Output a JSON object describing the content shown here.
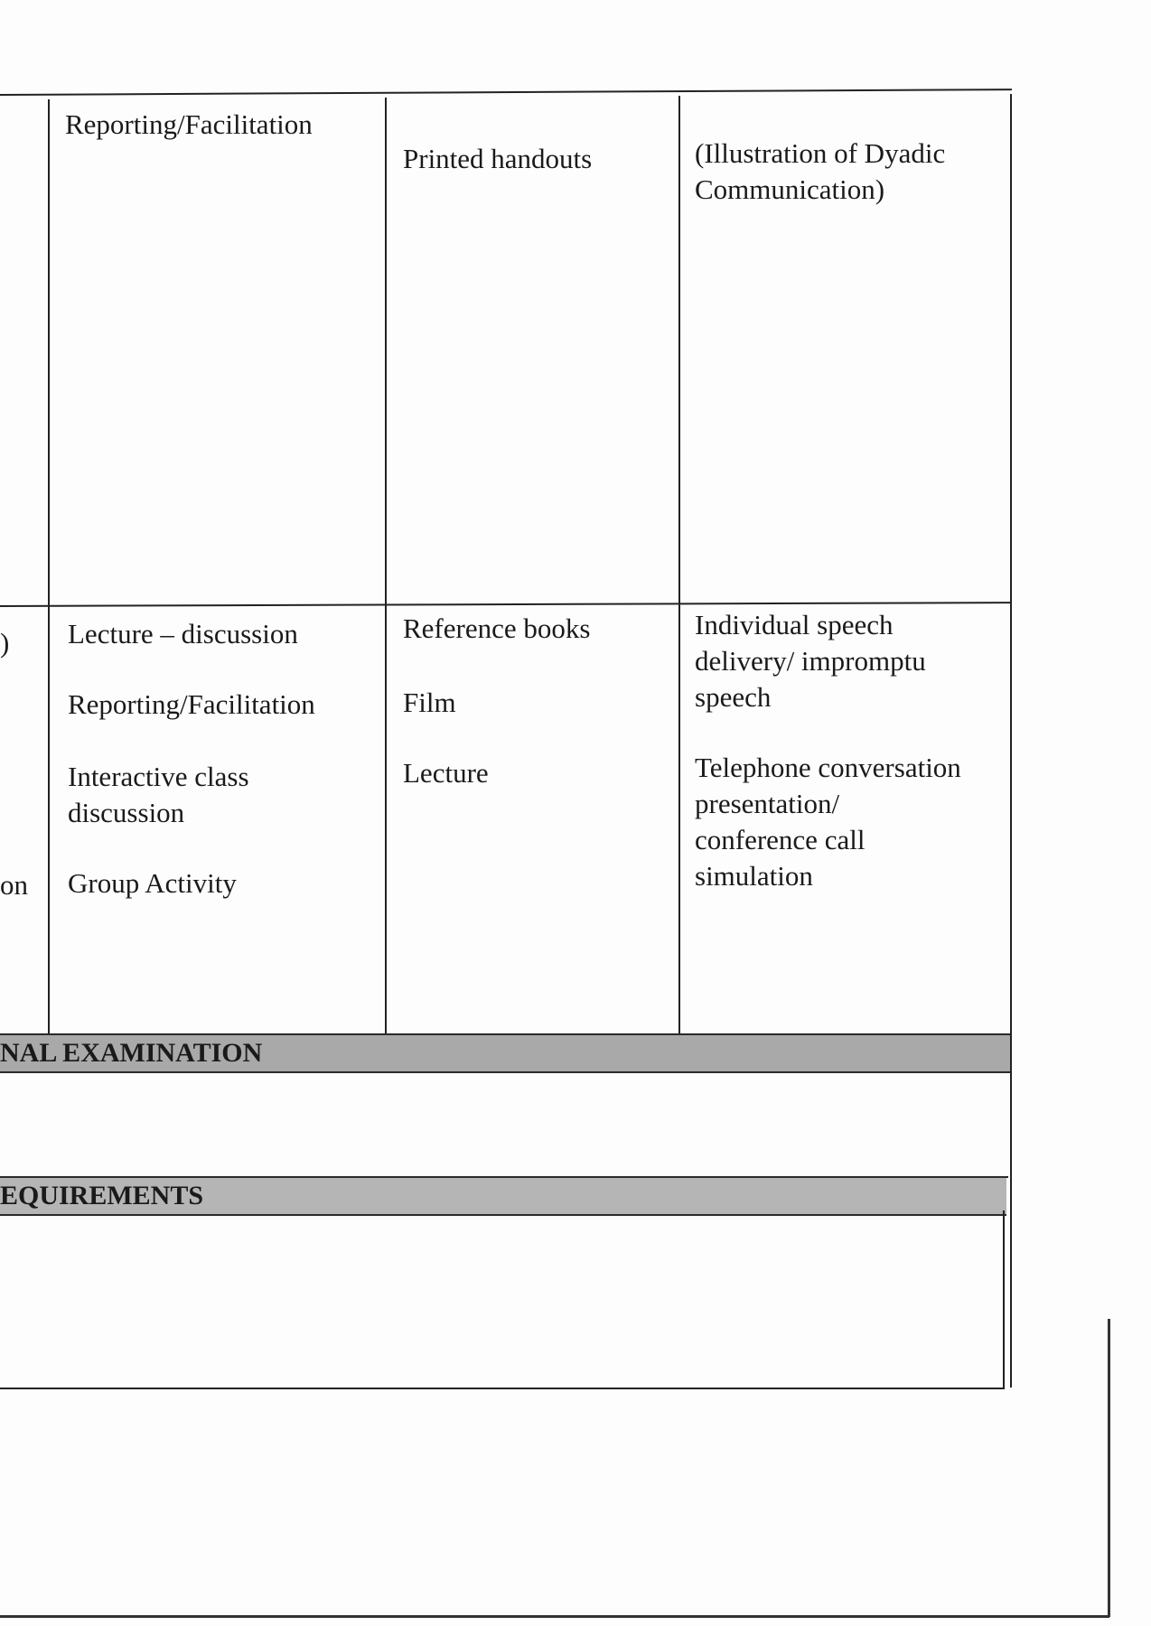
{
  "row1": {
    "col_method": "Reporting/Facilitation",
    "col_material": "Printed handouts",
    "col_assessment_line1": "(Illustration of Dyadic",
    "col_assessment_line2": "Communication)"
  },
  "row2": {
    "left_fragment_top": ")",
    "left_fragment_bottom": "on",
    "methods": [
      "Lecture – discussion",
      "Reporting/Facilitation",
      "Interactive class",
      "discussion",
      "Group Activity"
    ],
    "materials": [
      "Reference books",
      "Film",
      "Lecture"
    ],
    "assessment": [
      "Individual speech",
      "delivery/ impromptu",
      "speech",
      "Telephone conversation",
      "presentation/",
      "conference call",
      "simulation"
    ]
  },
  "sections": {
    "final_exam_label": "NAL EXAMINATION",
    "requirements_label": "EQUIREMENTS"
  },
  "colors": {
    "band": "#a9a9a9",
    "border": "#222222"
  }
}
